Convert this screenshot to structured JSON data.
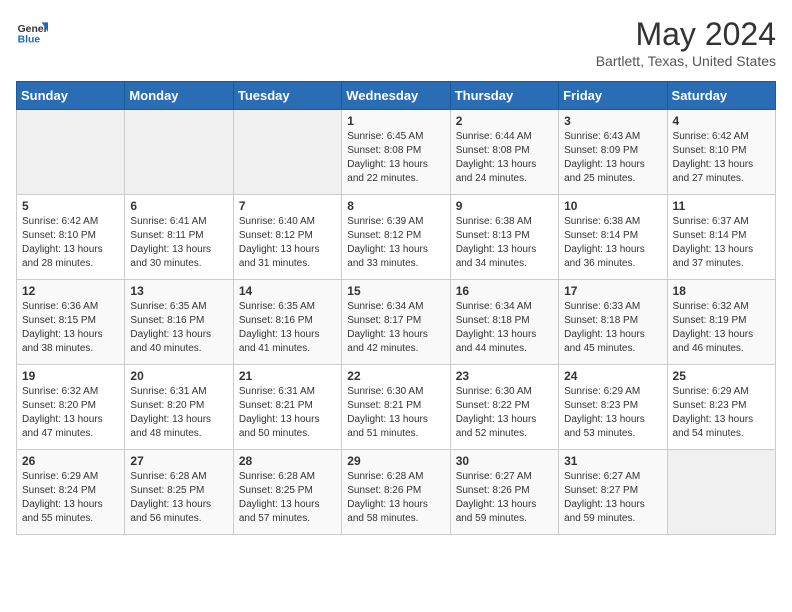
{
  "header": {
    "logo_general": "General",
    "logo_blue": "Blue",
    "month_year": "May 2024",
    "location": "Bartlett, Texas, United States"
  },
  "days_of_week": [
    "Sunday",
    "Monday",
    "Tuesday",
    "Wednesday",
    "Thursday",
    "Friday",
    "Saturday"
  ],
  "weeks": [
    [
      {
        "day": "",
        "info": ""
      },
      {
        "day": "",
        "info": ""
      },
      {
        "day": "",
        "info": ""
      },
      {
        "day": "1",
        "info": "Sunrise: 6:45 AM\nSunset: 8:08 PM\nDaylight: 13 hours and 22 minutes."
      },
      {
        "day": "2",
        "info": "Sunrise: 6:44 AM\nSunset: 8:08 PM\nDaylight: 13 hours and 24 minutes."
      },
      {
        "day": "3",
        "info": "Sunrise: 6:43 AM\nSunset: 8:09 PM\nDaylight: 13 hours and 25 minutes."
      },
      {
        "day": "4",
        "info": "Sunrise: 6:42 AM\nSunset: 8:10 PM\nDaylight: 13 hours and 27 minutes."
      }
    ],
    [
      {
        "day": "5",
        "info": "Sunrise: 6:42 AM\nSunset: 8:10 PM\nDaylight: 13 hours and 28 minutes."
      },
      {
        "day": "6",
        "info": "Sunrise: 6:41 AM\nSunset: 8:11 PM\nDaylight: 13 hours and 30 minutes."
      },
      {
        "day": "7",
        "info": "Sunrise: 6:40 AM\nSunset: 8:12 PM\nDaylight: 13 hours and 31 minutes."
      },
      {
        "day": "8",
        "info": "Sunrise: 6:39 AM\nSunset: 8:12 PM\nDaylight: 13 hours and 33 minutes."
      },
      {
        "day": "9",
        "info": "Sunrise: 6:38 AM\nSunset: 8:13 PM\nDaylight: 13 hours and 34 minutes."
      },
      {
        "day": "10",
        "info": "Sunrise: 6:38 AM\nSunset: 8:14 PM\nDaylight: 13 hours and 36 minutes."
      },
      {
        "day": "11",
        "info": "Sunrise: 6:37 AM\nSunset: 8:14 PM\nDaylight: 13 hours and 37 minutes."
      }
    ],
    [
      {
        "day": "12",
        "info": "Sunrise: 6:36 AM\nSunset: 8:15 PM\nDaylight: 13 hours and 38 minutes."
      },
      {
        "day": "13",
        "info": "Sunrise: 6:35 AM\nSunset: 8:16 PM\nDaylight: 13 hours and 40 minutes."
      },
      {
        "day": "14",
        "info": "Sunrise: 6:35 AM\nSunset: 8:16 PM\nDaylight: 13 hours and 41 minutes."
      },
      {
        "day": "15",
        "info": "Sunrise: 6:34 AM\nSunset: 8:17 PM\nDaylight: 13 hours and 42 minutes."
      },
      {
        "day": "16",
        "info": "Sunrise: 6:34 AM\nSunset: 8:18 PM\nDaylight: 13 hours and 44 minutes."
      },
      {
        "day": "17",
        "info": "Sunrise: 6:33 AM\nSunset: 8:18 PM\nDaylight: 13 hours and 45 minutes."
      },
      {
        "day": "18",
        "info": "Sunrise: 6:32 AM\nSunset: 8:19 PM\nDaylight: 13 hours and 46 minutes."
      }
    ],
    [
      {
        "day": "19",
        "info": "Sunrise: 6:32 AM\nSunset: 8:20 PM\nDaylight: 13 hours and 47 minutes."
      },
      {
        "day": "20",
        "info": "Sunrise: 6:31 AM\nSunset: 8:20 PM\nDaylight: 13 hours and 48 minutes."
      },
      {
        "day": "21",
        "info": "Sunrise: 6:31 AM\nSunset: 8:21 PM\nDaylight: 13 hours and 50 minutes."
      },
      {
        "day": "22",
        "info": "Sunrise: 6:30 AM\nSunset: 8:21 PM\nDaylight: 13 hours and 51 minutes."
      },
      {
        "day": "23",
        "info": "Sunrise: 6:30 AM\nSunset: 8:22 PM\nDaylight: 13 hours and 52 minutes."
      },
      {
        "day": "24",
        "info": "Sunrise: 6:29 AM\nSunset: 8:23 PM\nDaylight: 13 hours and 53 minutes."
      },
      {
        "day": "25",
        "info": "Sunrise: 6:29 AM\nSunset: 8:23 PM\nDaylight: 13 hours and 54 minutes."
      }
    ],
    [
      {
        "day": "26",
        "info": "Sunrise: 6:29 AM\nSunset: 8:24 PM\nDaylight: 13 hours and 55 minutes."
      },
      {
        "day": "27",
        "info": "Sunrise: 6:28 AM\nSunset: 8:25 PM\nDaylight: 13 hours and 56 minutes."
      },
      {
        "day": "28",
        "info": "Sunrise: 6:28 AM\nSunset: 8:25 PM\nDaylight: 13 hours and 57 minutes."
      },
      {
        "day": "29",
        "info": "Sunrise: 6:28 AM\nSunset: 8:26 PM\nDaylight: 13 hours and 58 minutes."
      },
      {
        "day": "30",
        "info": "Sunrise: 6:27 AM\nSunset: 8:26 PM\nDaylight: 13 hours and 59 minutes."
      },
      {
        "day": "31",
        "info": "Sunrise: 6:27 AM\nSunset: 8:27 PM\nDaylight: 13 hours and 59 minutes."
      },
      {
        "day": "",
        "info": ""
      }
    ]
  ]
}
